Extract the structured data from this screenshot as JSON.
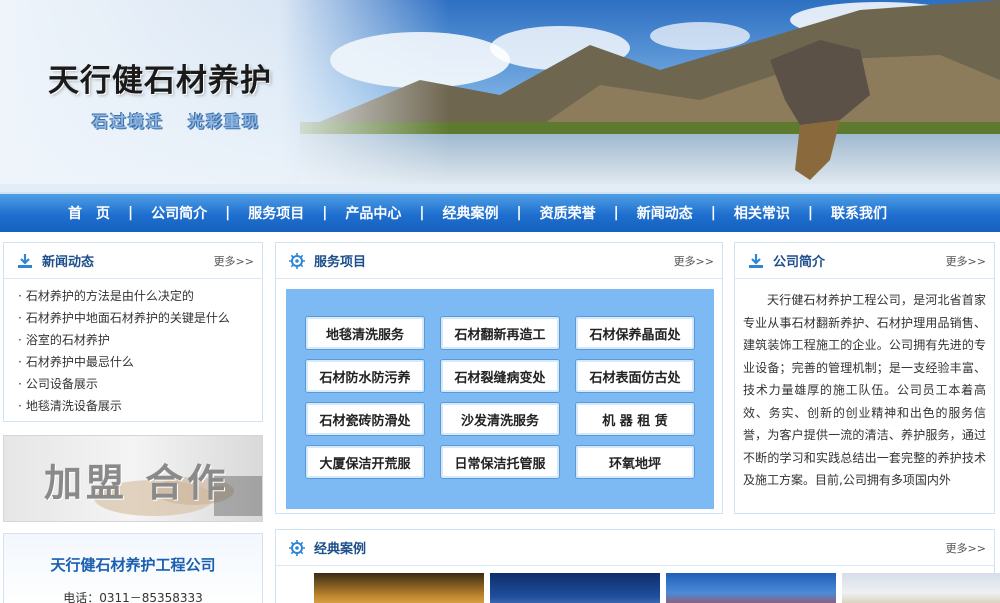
{
  "banner": {
    "title": "天行健石材养护",
    "slogan": [
      "石过境迁",
      "光彩重现"
    ]
  },
  "nav": {
    "items": [
      "首　页",
      "公司简介",
      "服务项目",
      "产品中心",
      "经典案例",
      "资质荣誉",
      "新闻动态",
      "相关常识",
      "联系我们"
    ],
    "separator": "|"
  },
  "news": {
    "title": "新闻动态",
    "more": "更多>>",
    "items": [
      "石材养护的方法是由什么决定的",
      "石材养护中地面石材养护的关键是什么",
      "浴室的石材养护",
      "石材养护中最忌什么",
      "公司设备展示",
      "地毯清洗设备展示"
    ]
  },
  "join": {
    "text": "加盟 合作"
  },
  "contact": {
    "company": "天行健石材养护工程公司",
    "phone": "电话：0311－85358333"
  },
  "services": {
    "title": "服务项目",
    "more": "更多>>",
    "items": [
      "地毯清洗服务",
      "石材翻新再造工",
      "石材保养晶面处",
      "石材防水防污养",
      "石材裂缝病变处",
      "石材表面仿古处",
      "石材瓷砖防滑处",
      "沙发清洗服务",
      "机 器 租 赁",
      "大厦保洁开荒服",
      "日常保洁托管服",
      "环氧地坪"
    ]
  },
  "intro": {
    "title": "公司简介",
    "more": "更多>>",
    "text": "天行健石材养护工程公司，是河北省首家专业从事石材翻新养护、石材护理用品销售、建筑装饰工程施工的企业。公司拥有先进的专业设备；完善的管理机制；是一支经验丰富、技术力量雄厚的施工队伍。公司员工本着高效、务实、创新的创业精神和出色的服务信誉，为客户提供一流的清洁、养护服务，通过不断的学习和实践总结出一套完整的养护技术及施工方案。目前,公司拥有多项国内外"
  },
  "cases": {
    "title": "经典案例",
    "more": "更多>>"
  },
  "colors": {
    "nav_blue": "#1f6fcf",
    "panel_title": "#1d4f8b",
    "service_bg": "#7db9f2",
    "company_blue": "#1a5fb0"
  },
  "icons": {
    "panel": "download-icon",
    "services": "gear-icon"
  }
}
